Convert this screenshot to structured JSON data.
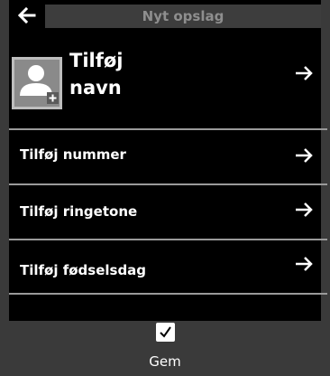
{
  "header": {
    "title": "Nyt opslag",
    "back_icon": "arrow-left-icon"
  },
  "contact": {
    "name_label": "Tilføj\nnavn",
    "avatar_icon": "add-contact-avatar-icon"
  },
  "rows": [
    {
      "label": "Tilføj nummer"
    },
    {
      "label": "Tilføj ringetone"
    },
    {
      "label": "Tilføj fødselsdag"
    }
  ],
  "footer": {
    "checkbox_checked": true,
    "save_label": "Gem"
  },
  "colors": {
    "background": "#000000",
    "bar": "#3a3a3a",
    "title_text": "#8e8e8e",
    "divider": "#9a9a9a",
    "avatar": "#8a8a8a"
  }
}
